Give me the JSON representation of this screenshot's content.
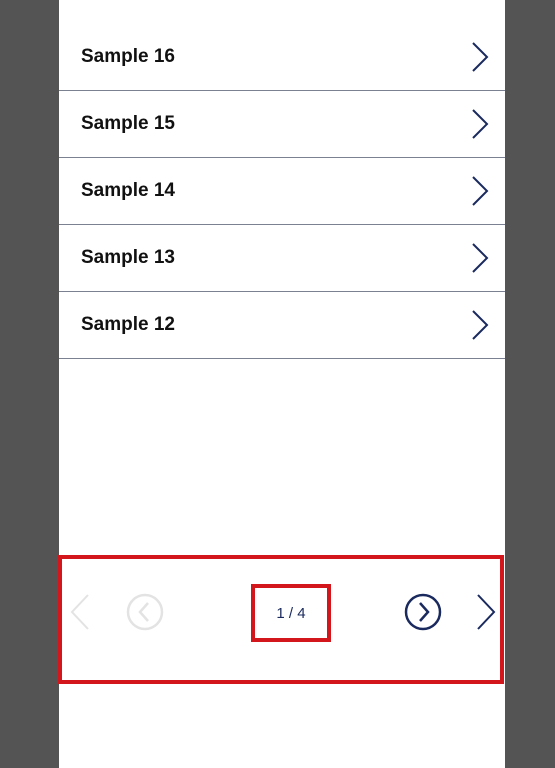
{
  "list": {
    "items": [
      {
        "label": "Sample 16"
      },
      {
        "label": "Sample 15"
      },
      {
        "label": "Sample 14"
      },
      {
        "label": "Sample 13"
      },
      {
        "label": "Sample 12"
      }
    ],
    "chevron_icon": "chevron-right-icon"
  },
  "pager": {
    "page_text": "1 / 4",
    "current_page": 1,
    "total_pages": 4,
    "first_button": {
      "icon": "chevron-left-icon",
      "enabled": false
    },
    "prev_button": {
      "icon": "circle-chevron-left-icon",
      "enabled": false
    },
    "next_button": {
      "icon": "circle-chevron-right-icon",
      "enabled": true
    },
    "last_button": {
      "icon": "chevron-right-icon",
      "enabled": true
    }
  },
  "colors": {
    "background": "#545454",
    "surface": "#ffffff",
    "accent": "#1a2a5e",
    "disabled": "#e3e3e3",
    "divider": "#7b8191",
    "highlight_border": "#d3161c"
  }
}
